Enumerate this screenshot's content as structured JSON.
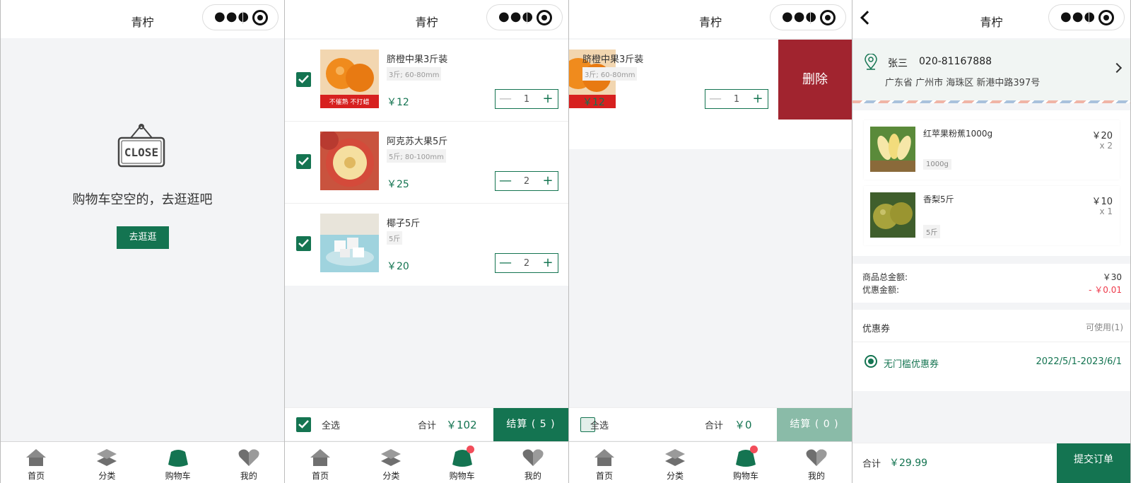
{
  "app_title": "青柠",
  "capsule": {
    "more_icon": "more-dots-icon",
    "close_icon": "record-target-icon"
  },
  "tabbar": [
    {
      "label": "首页",
      "icon": "home-icon"
    },
    {
      "label": "分类",
      "icon": "category-layers-icon"
    },
    {
      "label": "购物车",
      "icon": "cart-bag-icon"
    },
    {
      "label": "我的",
      "icon": "heart-profile-icon"
    }
  ],
  "empty_cart": {
    "message": "购物车空空的，去逛逛吧",
    "button": "去逛逛",
    "sign_text": "CLOSE"
  },
  "cart": {
    "items": [
      {
        "name": "脐橙中果3斤装",
        "spec": "3斤; 60-80mm",
        "price": "￥12",
        "qty": "1",
        "img_caption": "不催熟 不打蜡"
      },
      {
        "name": "阿克苏大果5斤",
        "spec": "5斤; 80-100mm",
        "price": "￥25",
        "qty": "2"
      },
      {
        "name": "椰子5斤",
        "spec": "5斤",
        "price": "￥20",
        "qty": "2"
      }
    ],
    "select_all": "全选",
    "total_label": "合计",
    "total": "￥102",
    "checkout": "结算 ( 5 )"
  },
  "swipe": {
    "item": {
      "name": "脐橙中果3斤装",
      "spec": "3斤; 60-80mm",
      "price": "￥12",
      "qty": "1"
    },
    "delete": "删除",
    "select_all": "全选",
    "total_label": "合计",
    "total": "￥0",
    "checkout": "结算 ( 0 )"
  },
  "order": {
    "address": {
      "name": "张三",
      "phone": "020-81167888",
      "detail": "广东省 广州市 海珠区 新港中路397号"
    },
    "items": [
      {
        "name": "红苹果粉蕉1000g",
        "spec": "1000g",
        "price": "￥20",
        "qty": "x 2"
      },
      {
        "name": "香梨5斤",
        "spec": "5斤",
        "price": "￥10",
        "qty": "x 1"
      }
    ],
    "goods_total_label": "商品总金额:",
    "goods_total": "￥30",
    "discount_label": "优惠金额:",
    "discount": "- ￥0.01",
    "coupon_title": "优惠券",
    "coupon_available": "可使用(1)",
    "coupon_name": "无门槛优惠券",
    "coupon_date": "2022/5/1-2023/6/1",
    "total_label": "合计",
    "total": "￥29.99",
    "submit": "提交订单"
  },
  "colors": {
    "brand": "#147451",
    "delete": "#a1242f",
    "badge": "#f24d5a",
    "discount": "#ee3a4b"
  }
}
